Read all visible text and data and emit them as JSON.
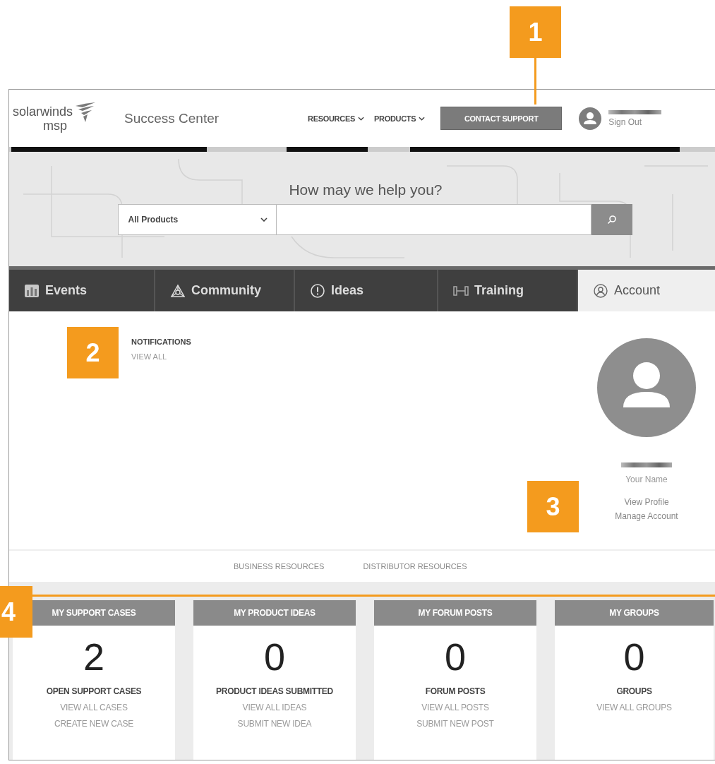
{
  "callouts": [
    {
      "label": "1"
    },
    {
      "label": "2"
    },
    {
      "label": "3"
    },
    {
      "label": "4"
    }
  ],
  "header": {
    "logo_word": "solarwinds",
    "logo_sub": "msp",
    "title": "Success Center",
    "nav": [
      {
        "label": "RESOURCES"
      },
      {
        "label": "PRODUCTS"
      }
    ],
    "contact_button": "CONTACT SUPPORT",
    "sign_out": "Sign Out"
  },
  "search": {
    "heading": "How may we help you?",
    "product_select": "All Products"
  },
  "tabs": [
    {
      "label": "Events",
      "selected": false
    },
    {
      "label": "Community",
      "selected": false
    },
    {
      "label": "Ideas",
      "selected": false
    },
    {
      "label": "Training",
      "selected": false
    },
    {
      "label": "Account",
      "selected": true
    }
  ],
  "notifications": {
    "title": "NOTIFICATIONS",
    "link": "VIEW ALL"
  },
  "profile": {
    "name_label": "Your Name",
    "links": [
      "View Profile",
      "Manage Account"
    ]
  },
  "resource_links": [
    "BUSINESS RESOURCES",
    "DISTRIBUTOR RESOURCES"
  ],
  "cards": [
    {
      "title": "MY SUPPORT CASES",
      "count": "2",
      "label": "OPEN SUPPORT CASES",
      "links": [
        "VIEW ALL CASES",
        "CREATE NEW CASE"
      ]
    },
    {
      "title": "MY PRODUCT IDEAS",
      "count": "0",
      "label": "PRODUCT IDEAS SUBMITTED",
      "links": [
        "VIEW ALL IDEAS",
        "SUBMIT NEW IDEA"
      ]
    },
    {
      "title": "MY FORUM POSTS",
      "count": "0",
      "label": "FORUM POSTS",
      "links": [
        "VIEW ALL POSTS",
        "SUBMIT NEW POST"
      ]
    },
    {
      "title": "MY GROUPS",
      "count": "0",
      "label": "GROUPS",
      "links": [
        "VIEW ALL GROUPS"
      ]
    }
  ]
}
